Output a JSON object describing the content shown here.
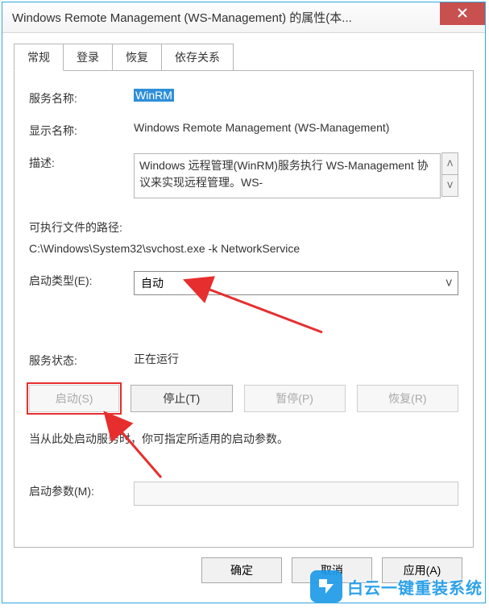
{
  "window": {
    "title": "Windows Remote Management (WS-Management) 的属性(本..."
  },
  "tabs": {
    "general": "常规",
    "logon": "登录",
    "recovery": "恢复",
    "dependencies": "依存关系"
  },
  "fields": {
    "service_name_label": "服务名称:",
    "service_name_value": "WinRM",
    "display_name_label": "显示名称:",
    "display_name_value": "Windows Remote Management (WS-Management)",
    "description_label": "描述:",
    "description_value": "Windows 远程管理(WinRM)服务执行 WS-Management 协议来实现远程管理。WS-",
    "exec_path_label": "可执行文件的路径:",
    "exec_path_value": "C:\\Windows\\System32\\svchost.exe -k NetworkService",
    "startup_type_label": "启动类型(E):",
    "startup_type_value": "自动",
    "service_status_label": "服务状态:",
    "service_status_value": "正在运行",
    "hint_text": "当从此处启动服务时，你可指定所适用的启动参数。",
    "start_params_label": "启动参数(M):",
    "start_params_value": ""
  },
  "buttons": {
    "start": "启动(S)",
    "stop": "停止(T)",
    "pause": "暂停(P)",
    "resume": "恢复(R)",
    "ok": "确定",
    "cancel": "取消",
    "apply": "应用(A)"
  },
  "watermark": {
    "text": "白云一键重装系统"
  }
}
